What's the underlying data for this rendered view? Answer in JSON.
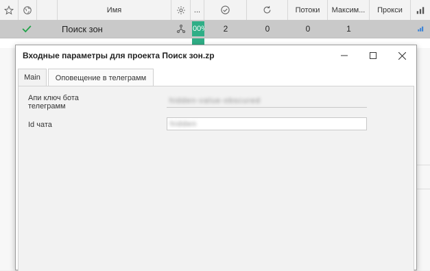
{
  "table": {
    "columns": {
      "name": "Имя",
      "ellipsis": "...",
      "threads": "Потоки",
      "max": "Максим...",
      "proxy": "Прокси"
    },
    "row": {
      "name": "Поиск зон",
      "percent": "00%",
      "success": "2",
      "retries": "0",
      "threads": "0",
      "max": "1"
    }
  },
  "dialog": {
    "title": "Входные параметры для проекта Поиск зон.zp",
    "tabs": [
      "Main",
      "Оповещение в телеграмм"
    ],
    "active_tab": "Оповещение в телеграмм",
    "fields": {
      "api_key_label_line1": "Апи ключ бота",
      "api_key_label_line2": "телеграмм",
      "api_key_value": "hidden-value-obscured",
      "chat_id_label": "Id чата",
      "chat_id_value": "hidden"
    }
  },
  "colors": {
    "accent_green": "#2fae86",
    "check_green": "#22a34a",
    "bar_blue": "#3b82d6"
  },
  "icons": [
    "star-icon",
    "globe-icon",
    "gear-icon",
    "check-circle-icon",
    "refresh-icon",
    "bar-chart-icon",
    "check-icon",
    "branch-icon",
    "minimize-icon",
    "maximize-icon",
    "close-icon"
  ]
}
